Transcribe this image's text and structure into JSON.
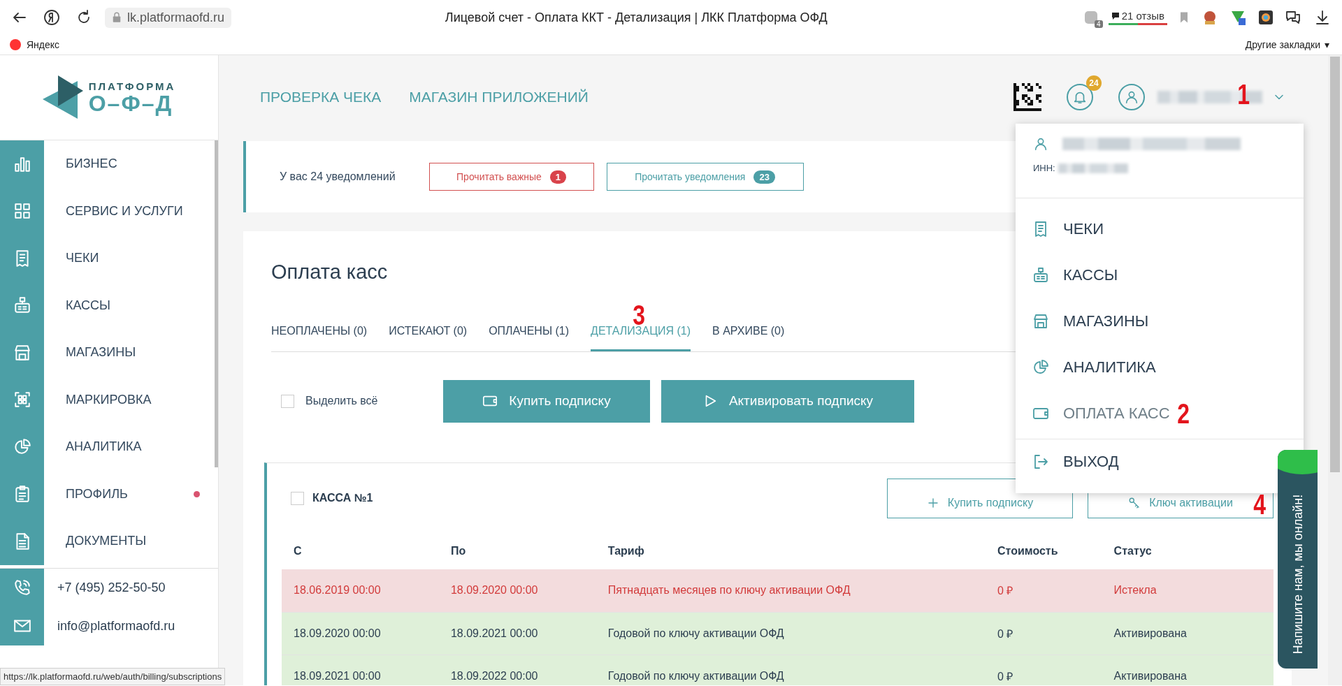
{
  "browser": {
    "url": "lk.platformaofd.ru",
    "title": "Лицевой счет - Оплата ККТ - Детализация | ЛКК Платформа ОФД",
    "extension_badge": "4",
    "reviews": "21 отзыв",
    "bookmarks": [
      {
        "label": "Яндекс"
      }
    ],
    "other_bookmarks": "Другие закладки",
    "other_bookmarks_caret": "▾",
    "status_url": "https://lk.platformaofd.ru/web/auth/billing/subscriptions"
  },
  "logo": {
    "line1": "ПЛАТФОРМА",
    "line2": "О–Ф–Д"
  },
  "sidebar": {
    "items": [
      {
        "label": "БИЗНЕС",
        "dot": false
      },
      {
        "label": "СЕРВИС И УСЛУГИ",
        "dot": false
      },
      {
        "label": "ЧЕКИ",
        "dot": false
      },
      {
        "label": "КАССЫ",
        "dot": false
      },
      {
        "label": "МАГАЗИНЫ",
        "dot": false
      },
      {
        "label": "МАРКИРОВКА",
        "dot": false
      },
      {
        "label": "АНАЛИТИКА",
        "dot": false
      },
      {
        "label": "ПРОФИЛЬ",
        "dot": true
      },
      {
        "label": "ДОКУМЕНТЫ",
        "dot": false
      }
    ],
    "contacts": [
      {
        "kind": "phone",
        "text": "+7 (495) 252-50-50"
      },
      {
        "kind": "email",
        "text": "info@platformaofd.ru"
      }
    ]
  },
  "header": {
    "links": [
      {
        "label": "ПРОВЕРКА ЧЕКА"
      },
      {
        "label": "МАГАЗИН ПРИЛОЖЕНИЙ"
      }
    ],
    "notifications_badge": "24",
    "user_annotation": "1"
  },
  "notifications": {
    "text": "У вас 24 уведомлений",
    "buttons": [
      {
        "kind": "important",
        "label": "Прочитать важные",
        "count": "1"
      },
      {
        "kind": "regular",
        "label": "Прочитать уведомления",
        "count": "23"
      }
    ]
  },
  "page": {
    "title": "Оплата касс",
    "tabs": [
      {
        "label": "НЕОПЛАЧЕНЫ (0)",
        "selected": false
      },
      {
        "label": "ИСТЕКАЮТ (0)",
        "selected": false
      },
      {
        "label": "ОПЛАЧЕНЫ (1)",
        "selected": false
      },
      {
        "label": "ДЕТАЛИЗАЦИЯ (1)",
        "selected": true,
        "annotation": "3"
      },
      {
        "label": "В АРХИВЕ (0)",
        "selected": false
      }
    ],
    "select_all": {
      "label": "Выделить всё",
      "checked": false
    },
    "actions": [
      {
        "label": "Купить подписку"
      },
      {
        "label": "Активировать подписку"
      }
    ]
  },
  "kassa": {
    "title": "КАССА №1",
    "checked": false,
    "actions": [
      {
        "label": "Купить подписку"
      },
      {
        "label": "Ключ активации",
        "annotation": "4"
      }
    ],
    "table": {
      "columns": [
        "С",
        "По",
        "Тариф",
        "Стоимость",
        "Статус"
      ],
      "rows": [
        {
          "kind": "expired",
          "cells": [
            "18.06.2019 00:00",
            "18.09.2020 00:00",
            "Пятнадцать месяцев по ключу активации ОФД",
            "0 ₽",
            "Истекла"
          ]
        },
        {
          "kind": "active",
          "cells": [
            "18.09.2020 00:00",
            "18.09.2021 00:00",
            "Годовой по ключу активации ОФД",
            "0 ₽",
            "Активирована"
          ]
        },
        {
          "kind": "active",
          "cells": [
            "18.09.2021 00:00",
            "18.09.2022 00:00",
            "Годовой по ключу активации ОФД",
            "0 ₽",
            "Активирована"
          ]
        }
      ]
    }
  },
  "user_menu": {
    "inn_label": "ИНН:",
    "items": [
      {
        "label": "ЧЕКИ",
        "selected": false
      },
      {
        "label": "КАССЫ",
        "selected": false
      },
      {
        "label": "МАГАЗИНЫ",
        "selected": false
      },
      {
        "label": "АНАЛИТИКА",
        "selected": false
      },
      {
        "label": "ОПЛАТА КАСС",
        "selected": true,
        "annotation": "2"
      }
    ],
    "logout": "ВЫХОД"
  },
  "chat_widget": {
    "text": "Напишите нам, мы онлайн!"
  }
}
